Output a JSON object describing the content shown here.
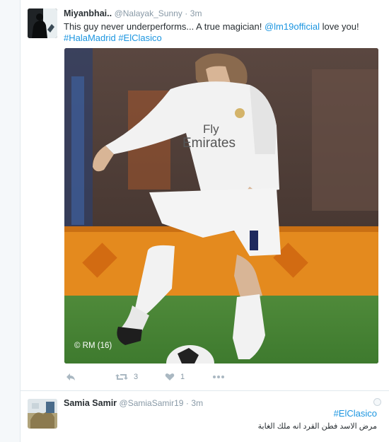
{
  "tweet1": {
    "fullname": "Miyanbhai..",
    "username": "@Nalayak_Sunny",
    "separator": "·",
    "time": "3m",
    "text_prefix": "This guy never underperforms... A true magician! ",
    "mention": "@lm19official",
    "text_suffix": " love you!",
    "hashtag1": "#HalaMadrid",
    "hashtag2": "#ElClasico",
    "photo": {
      "sponsor": "Fly Emirates",
      "credit": "© RM (16)"
    },
    "actions": {
      "reply_icon": "reply-icon",
      "retweet_icon": "retweet-icon",
      "retweet_count": "3",
      "like_icon": "heart-icon",
      "like_count": "1",
      "more_icon": "more-icon"
    }
  },
  "tweet2": {
    "fullname": "Samia Samir",
    "username": "@SamiaSamir19",
    "separator": "·",
    "time": "3m",
    "hashtag": "#ElClasico",
    "text": "مرض الاسد فطن القرد انه ملك الغابة"
  },
  "colors": {
    "link": "#1b95e0",
    "text": "#292f33",
    "muted": "#8899a6",
    "icon": "#aab8c2"
  }
}
